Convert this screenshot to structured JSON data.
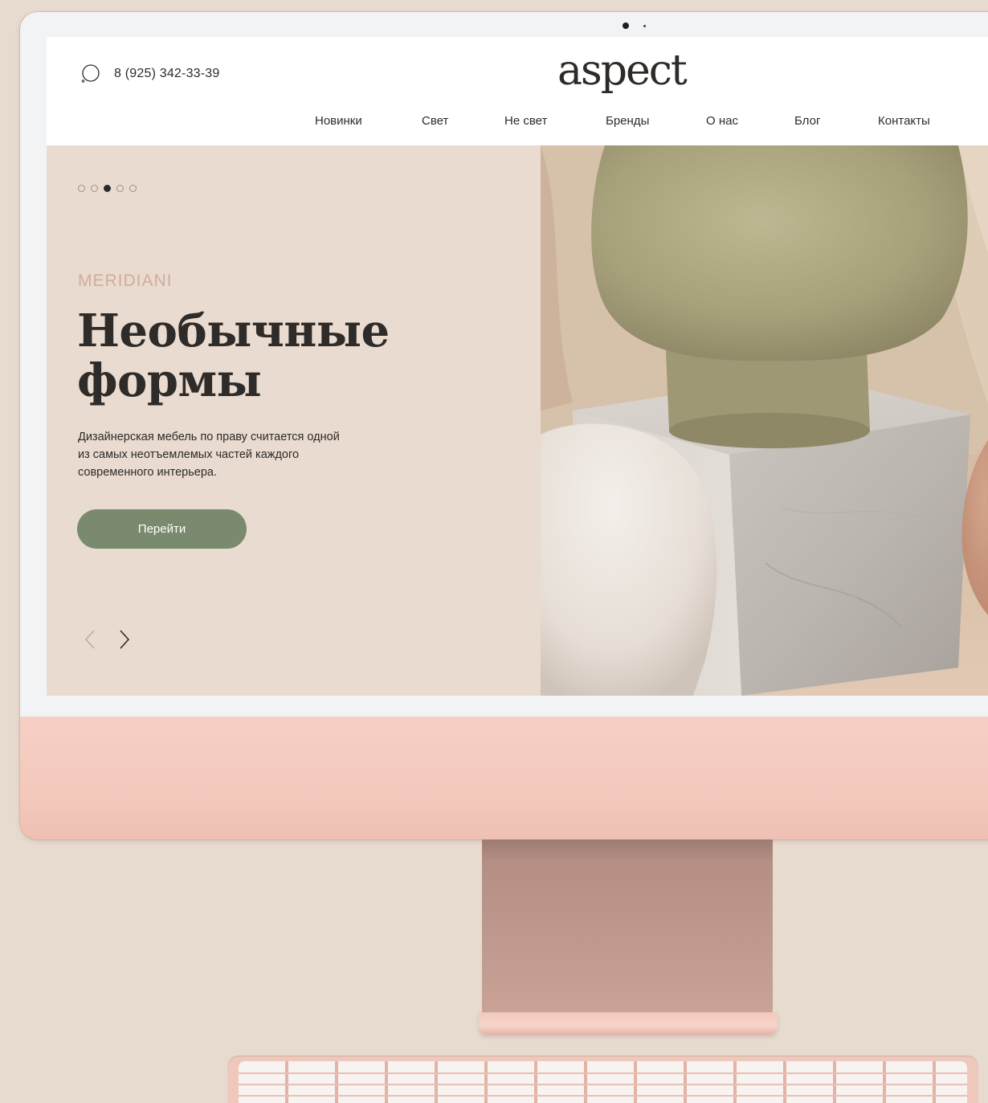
{
  "header": {
    "phone": "8 (925) 342-33-39",
    "logo": "aspect",
    "nav": [
      "Новинки",
      "Свет",
      "Не свет",
      "Бренды",
      "О нас",
      "Блог",
      "Контакты"
    ]
  },
  "hero": {
    "slides_total": 5,
    "active_slide": 3,
    "brand": "MERIDIANI",
    "title": "Необычные формы",
    "description": "Дизайнерская мебель по праву считается одной из самых неотъемлемых частей каждого современного интерьера.",
    "cta_label": "Перейти",
    "icons": {
      "prev": "chevron-left-icon",
      "next": "chevron-right-icon",
      "phone": "phone-icon"
    }
  },
  "colors": {
    "background": "#e7dacf",
    "hero_panel": "#e9dbcf",
    "brand_label": "#d0ad9e",
    "button": "#7a8a6f",
    "imac_chin": "#f4c9bd"
  }
}
